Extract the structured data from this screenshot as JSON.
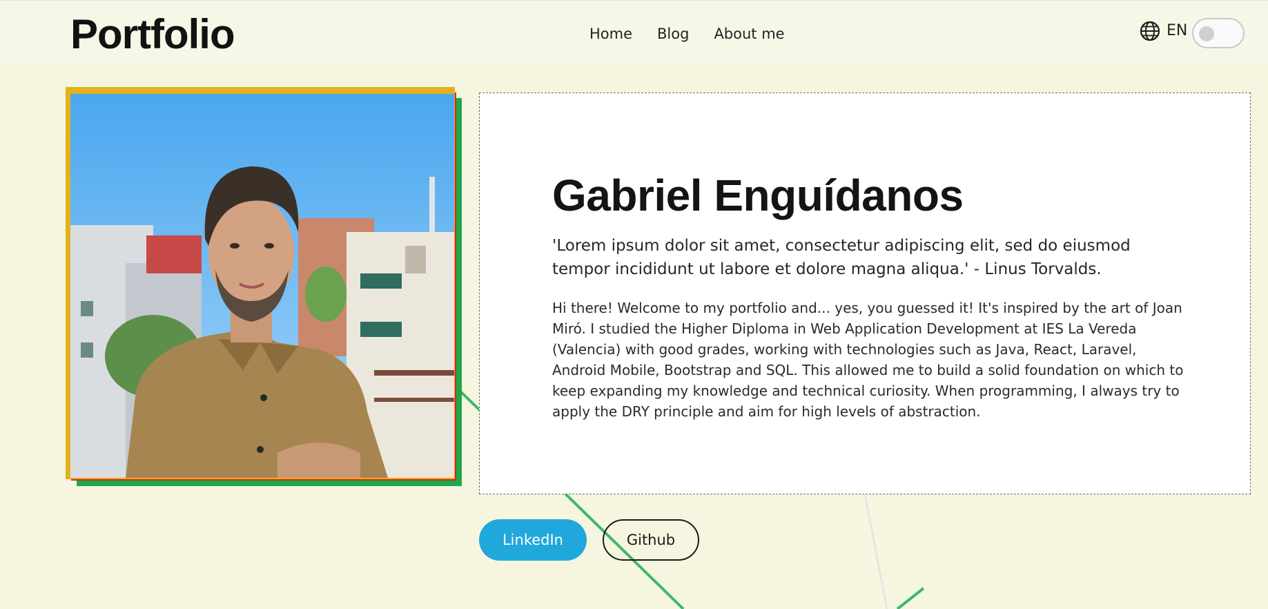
{
  "header": {
    "brand": "Portfolio",
    "nav": [
      {
        "label": "Home"
      },
      {
        "label": "Blog"
      },
      {
        "label": "About me"
      }
    ],
    "language": {
      "icon": "globe-icon",
      "code": "EN"
    },
    "theme_toggle": {
      "state": "off"
    }
  },
  "profile": {
    "photo": {
      "frame_colors": [
        "#e3b21b",
        "#d8232c",
        "#1fa64a"
      ]
    },
    "name": "Gabriel Enguídanos",
    "quote": "'Lorem ipsum dolor sit amet, consectetur adipiscing elit, sed do eiusmod tempor incididunt ut labore et dolore magna aliqua.' - Linus Torvalds.",
    "bio": "Hi there! Welcome to my portfolio and... yes, you guessed it! It's inspired by the art of Joan Miró. I studied the Higher Diploma in Web Application Development at IES La Vereda (Valencia) with good grades, working with technologies such as Java, React, Laravel, Android Mobile, Bootstrap and SQL. This allowed me to build a solid foundation on which to keep expanding my knowledge and technical curiosity. When programming, I always try to apply the DRY principle and aim for high levels of abstraction."
  },
  "actions": {
    "linkedin_label": "LinkedIn",
    "github_label": "Github"
  },
  "colors": {
    "background": "#f5f5e0",
    "linkedin": "#20a8dc",
    "accent_green": "#1fa64a"
  }
}
